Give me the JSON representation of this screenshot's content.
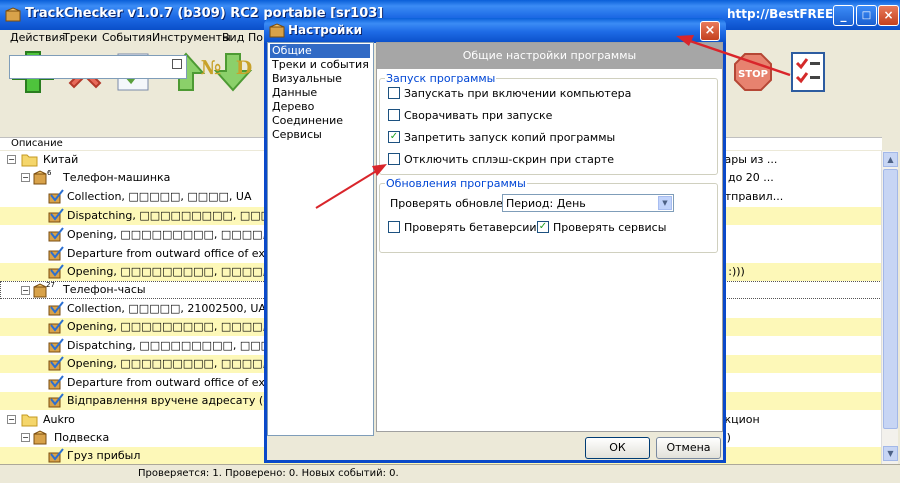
{
  "main_window": {
    "title": "TrackChecker v1.0.7 (b309) RC2 portable [sr103]",
    "watermark": "http://BestFREE.ru",
    "menu": [
      "Действия",
      "Треки",
      "События",
      "Инструменты",
      "Вид",
      "Пом"
    ],
    "search_value": "",
    "col_header": "Описание",
    "status": "Проверяется: 1. Проверено: 0. Новых событий: 0.",
    "tree": [
      {
        "label": "Китай",
        "right": "вары из ...",
        "hl": false
      },
      {
        "label": "Телефон-машинка",
        "badge": "6",
        "right": "ь до 20 ...",
        "hl": false
      },
      {
        "label": "Collection, □□□□□, □□□□, UA",
        "right": "отправил...",
        "hl": false
      },
      {
        "label": "Dispatching, □□□□□□□□□, □□□",
        "right": "",
        "hl": true
      },
      {
        "label": "Opening, □□□□□□□□□, □□□□, □",
        "right": "",
        "hl": false
      },
      {
        "label": "Departure from outward office of excha",
        "right": "",
        "hl": false
      },
      {
        "label": "Opening, □□□□□□□□□, □□□□, □",
        "right": "e :)))",
        "hl": true
      },
      {
        "label": "Телефон-часы",
        "badge": "27",
        "right": "",
        "hl": false
      },
      {
        "label": "Collection, □□□□□, 21002500, UA",
        "right": "",
        "hl": false
      },
      {
        "label": "Opening, □□□□□□□□□, □□□□, □",
        "right": "",
        "hl": true
      },
      {
        "label": "Dispatching, □□□□□□□□□, □□□",
        "right": "",
        "hl": false
      },
      {
        "label": "Opening, □□□□□□□□□, □□□□, □",
        "right": "",
        "hl": true
      },
      {
        "label": "Departure from outward office of excha",
        "right": "",
        "hl": false
      },
      {
        "label": "Відправлення вручене адресату (одер",
        "right": "",
        "hl": true
      },
      {
        "label": "Aukro",
        "right": "укцион",
        "hl": false
      },
      {
        "label": "Подвеска",
        "right": ")))",
        "hl": false
      },
      {
        "label": "Груз прибыл",
        "right": "",
        "hl": true
      }
    ]
  },
  "dialog": {
    "title": "Настройки",
    "nav": [
      "Общие",
      "Треки и события",
      "Визуальные",
      "Данные",
      "Дерево",
      "Соединение",
      "Сервисы"
    ],
    "panel_title": "Общие настройки программы",
    "group_startup": {
      "caption": "Запуск программы",
      "options": [
        {
          "label": "Запускать при включении компьютера",
          "checked": false
        },
        {
          "label": "Сворачивать при запуске",
          "checked": false
        },
        {
          "label": "Запретить запуск копий программы",
          "checked": true
        },
        {
          "label": "Отключить сплэш-скрин при старте",
          "checked": false
        }
      ]
    },
    "group_updates": {
      "caption": "Обновления программы",
      "check_label": "Проверять обновления:",
      "period_value": "Период: День",
      "beta_label": "Проверять бетаверсии",
      "beta_checked": false,
      "services_label": "Проверять сервисы",
      "services_checked": true
    },
    "ok_label": "ОК",
    "cancel_label": "Отмена"
  },
  "colors": {
    "xp_title": "#0a5fd8",
    "highlight_row": "#fdf8b8",
    "arrow": "#d9252b",
    "group_caption": "#0046d5"
  }
}
